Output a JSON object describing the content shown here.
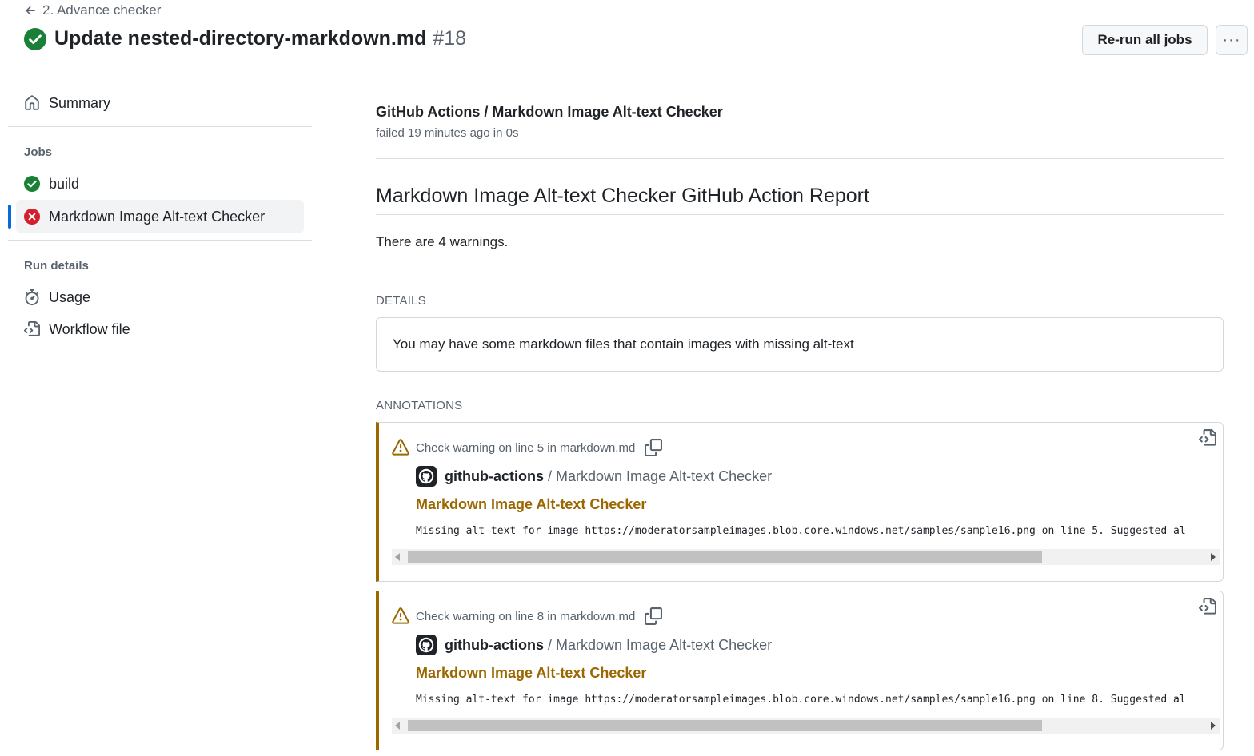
{
  "header": {
    "back_label": "2. Advance checker",
    "title": "Update nested-directory-markdown.md",
    "run_number": "#18",
    "rerun_label": "Re-run all jobs",
    "more_label": "···"
  },
  "sidebar": {
    "summary_label": "Summary",
    "jobs_heading": "Jobs",
    "jobs": [
      {
        "label": "build",
        "status": "success"
      },
      {
        "label": "Markdown Image Alt-text Checker",
        "status": "failure"
      }
    ],
    "run_details_heading": "Run details",
    "usage_label": "Usage",
    "workflow_file_label": "Workflow file"
  },
  "main": {
    "check_name": "GitHub Actions / Markdown Image Alt-text Checker",
    "check_meta": "failed 19 minutes ago in 0s",
    "report_title": "Markdown Image Alt-text Checker GitHub Action Report",
    "warnings_text": "There are 4 warnings.",
    "details_label": "DETAILS",
    "details_text": "You may have some markdown files that contain images with missing alt-text",
    "annotations_label": "ANNOTATIONS",
    "annotations": [
      {
        "heading": "Check warning on line 5 in markdown.md",
        "author": "github-actions",
        "author_suffix": "/ Markdown Image Alt-text Checker",
        "title": "Markdown Image Alt-text Checker",
        "message": "Missing alt-text for image https://moderatorsampleimages.blob.core.windows.net/samples/sample16.png on line 5. Suggested al"
      },
      {
        "heading": "Check warning on line 8 in markdown.md",
        "author": "github-actions",
        "author_suffix": "/ Markdown Image Alt-text Checker",
        "title": "Markdown Image Alt-text Checker",
        "message": "Missing alt-text for image https://moderatorsampleimages.blob.core.windows.net/samples/sample16.png on line 8. Suggested al"
      }
    ]
  },
  "colors": {
    "success": "#1a7f37",
    "failure": "#cf222e",
    "warning": "#9a6700",
    "accent": "#0969da"
  }
}
